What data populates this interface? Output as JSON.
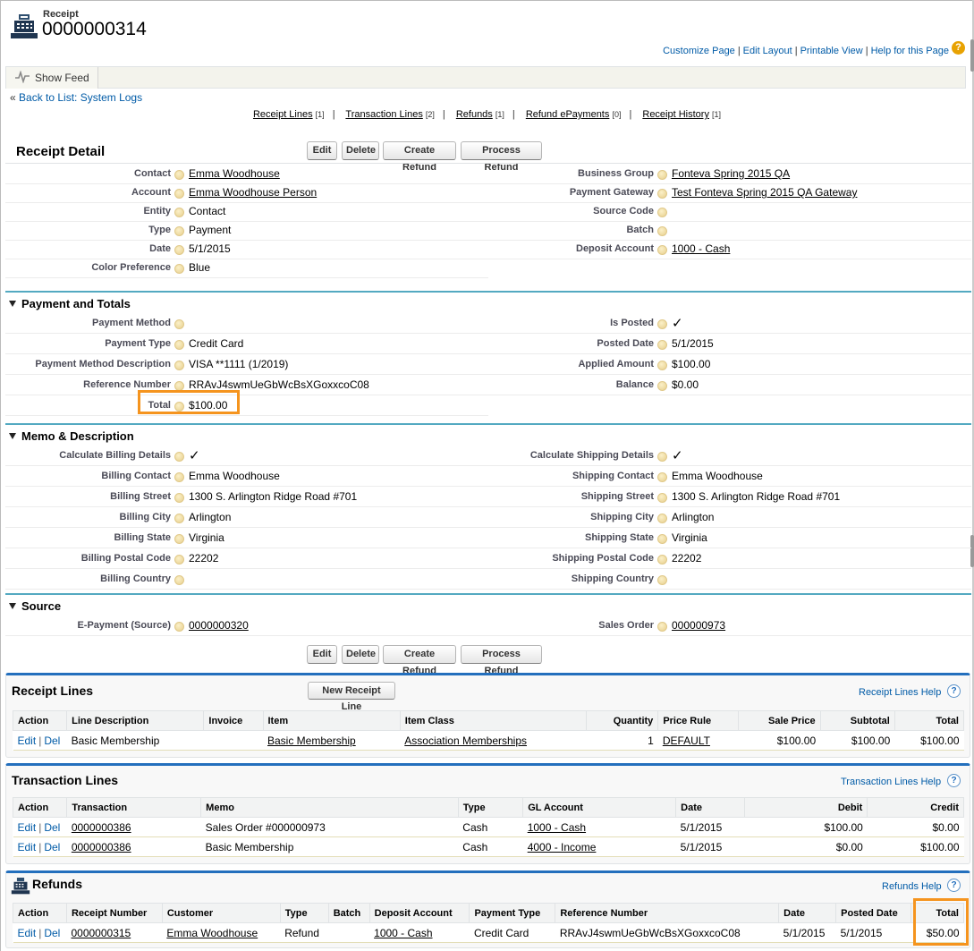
{
  "header": {
    "type_label": "Receipt",
    "title": "0000000314",
    "links": [
      "Customize Page",
      "Edit Layout",
      "Printable View",
      "Help for this Page"
    ],
    "help_icon": "help-icon"
  },
  "feed": {
    "show_feed": "Show Feed"
  },
  "back_link": {
    "prefix": "«",
    "label": "Back to List: System Logs"
  },
  "related_links": [
    {
      "label": "Receipt Lines",
      "count": "[1]"
    },
    {
      "label": "Transaction Lines",
      "count": "[2]"
    },
    {
      "label": "Refunds",
      "count": "[1]"
    },
    {
      "label": "Refund ePayments",
      "count": "[0]"
    },
    {
      "label": "Receipt History",
      "count": "[1]"
    }
  ],
  "buttons": {
    "edit": "Edit",
    "delete": "Delete",
    "create_refund": "Create Refund",
    "process_refund": "Process Refund"
  },
  "receipt_detail": {
    "title": "Receipt Detail",
    "left": [
      {
        "label": "Contact",
        "value": "Emma Woodhouse"
      },
      {
        "label": "Account",
        "value": "Emma Woodhouse Person"
      },
      {
        "label": "Entity",
        "value": "Contact"
      },
      {
        "label": "Type",
        "value": "Payment"
      },
      {
        "label": "Date",
        "value": "5/1/2015"
      },
      {
        "label": "Color Preference",
        "value": "Blue"
      }
    ],
    "right": [
      {
        "label": "Business Group",
        "value": "Fonteva Spring 2015 QA"
      },
      {
        "label": "Payment Gateway",
        "value": "Test Fonteva Spring 2015 QA Gateway"
      },
      {
        "label": "Source Code",
        "value": ""
      },
      {
        "label": "Batch",
        "value": ""
      },
      {
        "label": "Deposit Account",
        "value": "1000 - Cash"
      }
    ]
  },
  "payment_totals": {
    "title": "Payment and Totals",
    "left": [
      {
        "label": "Payment Method",
        "value": ""
      },
      {
        "label": "Payment Type",
        "value": "Credit Card"
      },
      {
        "label": "Payment Method Description",
        "value": "VISA **1111 (1/2019)"
      },
      {
        "label": "Reference Number",
        "value": "RRAvJ4swmUeGbWcBsXGoxxcoC08"
      },
      {
        "label": "Total",
        "value": "$100.00"
      }
    ],
    "right": [
      {
        "label": "Is Posted",
        "value": "✓"
      },
      {
        "label": "Posted Date",
        "value": "5/1/2015"
      },
      {
        "label": "Applied Amount",
        "value": "$100.00"
      },
      {
        "label": "Balance",
        "value": "$0.00"
      }
    ]
  },
  "memo": {
    "title": "Memo & Description",
    "left": [
      {
        "label": "Calculate Billing Details",
        "value": "✓"
      },
      {
        "label": "Billing Contact",
        "value": "Emma Woodhouse"
      },
      {
        "label": "Billing Street",
        "value": "1300 S. Arlington Ridge Road #701"
      },
      {
        "label": "Billing City",
        "value": "Arlington"
      },
      {
        "label": "Billing State",
        "value": "Virginia"
      },
      {
        "label": "Billing Postal Code",
        "value": "22202"
      },
      {
        "label": "Billing Country",
        "value": ""
      }
    ],
    "right": [
      {
        "label": "Calculate Shipping Details",
        "value": "✓"
      },
      {
        "label": "Shipping Contact",
        "value": "Emma Woodhouse"
      },
      {
        "label": "Shipping Street",
        "value": "1300 S. Arlington Ridge Road #701"
      },
      {
        "label": "Shipping City",
        "value": "Arlington"
      },
      {
        "label": "Shipping State",
        "value": "Virginia"
      },
      {
        "label": "Shipping Postal Code",
        "value": "22202"
      },
      {
        "label": "Shipping Country",
        "value": ""
      }
    ]
  },
  "source": {
    "title": "Source",
    "left": [
      {
        "label": "E-Payment (Source)",
        "value": "0000000320"
      }
    ],
    "right": [
      {
        "label": "Sales Order",
        "value": "000000973"
      }
    ]
  },
  "receipt_lines": {
    "title": "Receipt Lines",
    "new_button": "New Receipt Line",
    "help": "Receipt Lines Help",
    "columns": [
      "Action",
      "Line Description",
      "Invoice",
      "Item",
      "Item Class",
      "Quantity",
      "Price Rule",
      "Sale Price",
      "Subtotal",
      "Total"
    ],
    "rows": [
      {
        "description": "Basic Membership",
        "invoice": "",
        "item": "Basic Membership",
        "item_class": "Association Memberships",
        "quantity": "1",
        "price_rule": "DEFAULT",
        "sale_price": "$100.00",
        "subtotal": "$100.00",
        "total": "$100.00"
      }
    ]
  },
  "transaction_lines": {
    "title": "Transaction Lines",
    "help": "Transaction Lines Help",
    "columns": [
      "Action",
      "Transaction",
      "Memo",
      "Type",
      "GL Account",
      "Date",
      "Debit",
      "Credit"
    ],
    "rows": [
      {
        "transaction": "0000000386",
        "memo": "Sales Order #000000973",
        "type": "Cash",
        "gl_account": "1000 - Cash",
        "date": "5/1/2015",
        "debit": "$100.00",
        "credit": "$0.00"
      },
      {
        "transaction": "0000000386",
        "memo": "Basic Membership",
        "type": "Cash",
        "gl_account": "4000 - Income",
        "date": "5/1/2015",
        "debit": "$0.00",
        "credit": "$100.00"
      }
    ]
  },
  "refunds": {
    "title": "Refunds",
    "help": "Refunds Help",
    "columns": [
      "Action",
      "Receipt Number",
      "Customer",
      "Type",
      "Batch",
      "Deposit Account",
      "Payment Type",
      "Reference Number",
      "Date",
      "Posted Date",
      "Total"
    ],
    "rows": [
      {
        "receipt_number": "0000000315",
        "customer": "Emma Woodhouse",
        "type": "Refund",
        "batch": "",
        "deposit_account": "1000 - Cash",
        "payment_type": "Credit Card",
        "reference_number": "RRAvJ4swmUeGbWcBsXGoxxcoC08",
        "date": "5/1/2015",
        "posted_date": "5/1/2015",
        "total": "$50.00"
      }
    ]
  },
  "row_actions": {
    "edit": "Edit",
    "sep": "|",
    "del": "Del"
  },
  "colors": {
    "accent_line": "#53a9c1",
    "panel_border": "#236fbd",
    "highlight": "#f5941e",
    "link": "#015ba7"
  }
}
